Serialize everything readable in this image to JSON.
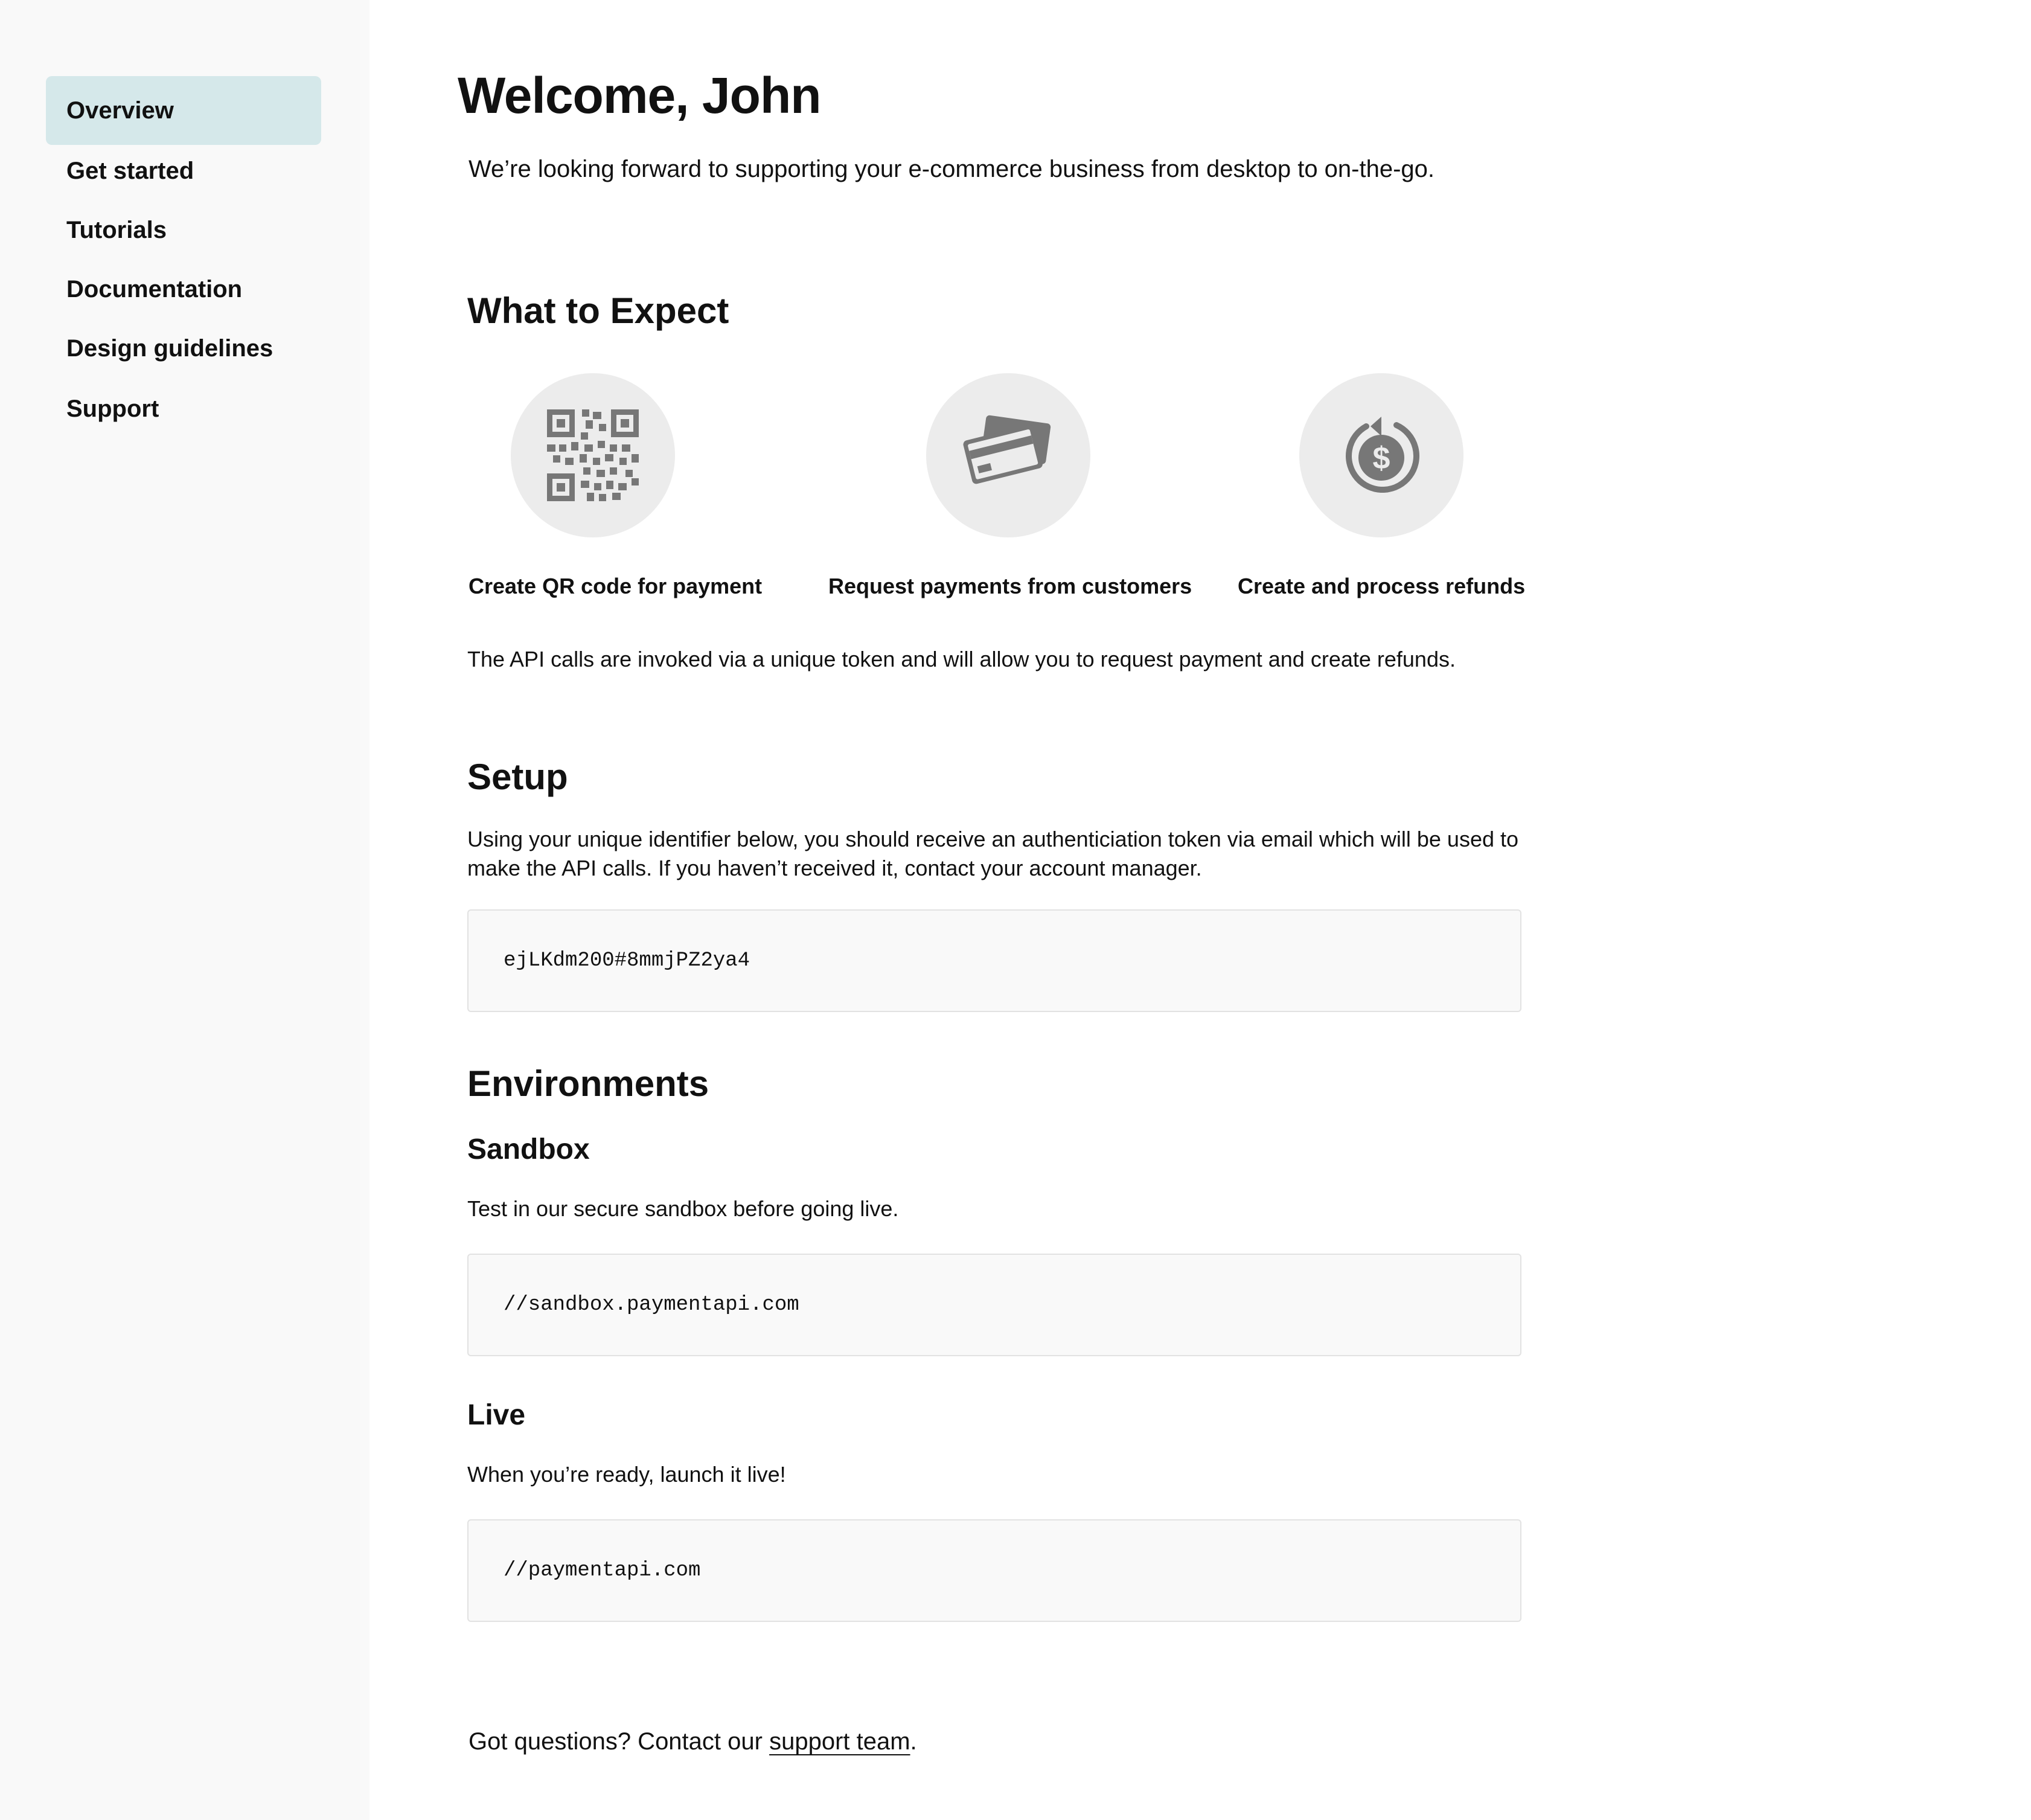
{
  "sidebar": {
    "items": [
      {
        "label": "Overview",
        "active": true
      },
      {
        "label": "Get started"
      },
      {
        "label": "Tutorials"
      },
      {
        "label": "Documentation"
      },
      {
        "label": "Design guidelines"
      },
      {
        "label": "Support"
      }
    ]
  },
  "header": {
    "title": "Welcome, John",
    "subtitle": "We’re looking forward to supporting your e-commerce business from desktop to on-the-go."
  },
  "expect": {
    "heading": "What to Expect",
    "features": [
      {
        "icon": "qr-code-icon",
        "label": "Create QR code for payment"
      },
      {
        "icon": "credit-cards-icon",
        "label": "Request payments from customers"
      },
      {
        "icon": "refund-dollar-icon",
        "label": "Create and process refunds"
      }
    ],
    "note": "The API calls are invoked via a unique token and will allow you to request payment and create refunds."
  },
  "setup": {
    "heading": "Setup",
    "text_line1": "Using your unique identifier below, you should receive an authenticiation token via email which will be used to",
    "text_line2": "make the API calls. If you haven’t received it, contact your account manager.",
    "identifier": "ejLKdm200#8mmjPZ2ya4"
  },
  "environments": {
    "heading": "Environments",
    "sandbox": {
      "heading": "Sandbox",
      "text": "Test in our secure sandbox before going live.",
      "url": "//sandbox.paymentapi.com"
    },
    "live": {
      "heading": "Live",
      "text": "When you’re ready, launch it live!",
      "url": "//paymentapi.com"
    }
  },
  "footer": {
    "text_before": "Got questions? Contact our ",
    "link": "support team",
    "text_after": "."
  },
  "colors": {
    "sidebar_bg": "#f9f9f9",
    "active_item_bg": "#d5e8ea",
    "icon_circle_bg": "#ececec",
    "icon_fill": "#777777",
    "code_bg": "#f9f9f9"
  }
}
